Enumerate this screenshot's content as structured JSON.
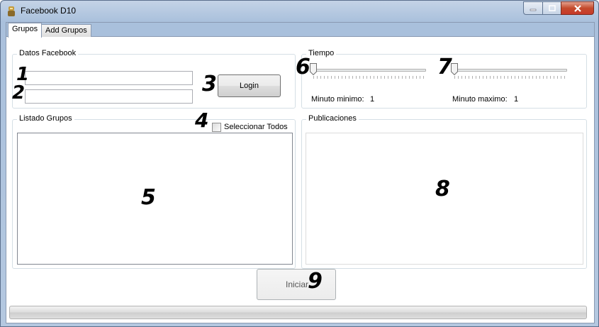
{
  "window": {
    "title": "Facebook D10",
    "icon": "app-icon"
  },
  "tabs": [
    {
      "label": "Grupos",
      "active": true
    },
    {
      "label": "Add Grupos",
      "active": false
    }
  ],
  "datos_facebook": {
    "legend": "Datos Facebook",
    "username_value": "",
    "password_value": "",
    "login_label": "Login"
  },
  "tiempo": {
    "legend": "Tiempo",
    "min_label": "Minuto minimo:",
    "min_value": "1",
    "max_label": "Minuto maximo:",
    "max_value": "1",
    "min_slider_level": 0,
    "max_slider_level": 0
  },
  "listado": {
    "legend": "Listado Grupos",
    "select_all_label": "Seleccionar Todos",
    "select_all_checked": false,
    "items": []
  },
  "publicaciones": {
    "legend": "Publicaciones",
    "items": []
  },
  "actions": {
    "start_label": "Iniciar"
  },
  "progress": {
    "value": 0
  },
  "annotations": [
    "1",
    "2",
    "3",
    "4",
    "5",
    "6",
    "7",
    "8",
    "9"
  ]
}
